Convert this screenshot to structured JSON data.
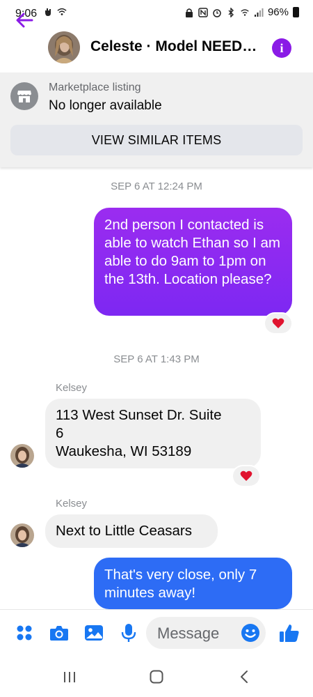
{
  "status_bar": {
    "time": "9:06",
    "battery": "96%"
  },
  "header": {
    "title": "Celeste · Model NEED…"
  },
  "listing": {
    "label": "Marketplace listing",
    "status": "No longer available",
    "button": "VIEW SIMILAR ITEMS"
  },
  "timestamps": [
    "SEP 6 AT 12:24 PM",
    "SEP 6 AT 1:43 PM"
  ],
  "messages": [
    {
      "direction": "outgoing",
      "text": "2nd person I contacted is able to watch Ethan so I am able to do 9am to 1pm on the 13th. Location please?",
      "reaction": "heart"
    },
    {
      "direction": "incoming",
      "sender": "Kelsey",
      "lines": [
        "113 West Sunset Dr. Suite",
        "6",
        "Waukesha, WI 53189"
      ],
      "reaction": "heart"
    },
    {
      "direction": "incoming",
      "sender": "Kelsey",
      "text": "Next to Little Ceasars"
    },
    {
      "direction": "outgoing",
      "text": "That's very close, only 7 minutes away!"
    }
  ],
  "composer": {
    "placeholder": "Message"
  },
  "colors": {
    "accent": "#8a1be6",
    "outgoing_purple": "#8a2cf1",
    "outgoing_blue": "#2d6cf5",
    "incoming": "#f0f0f0",
    "heart": "#e0142f"
  }
}
